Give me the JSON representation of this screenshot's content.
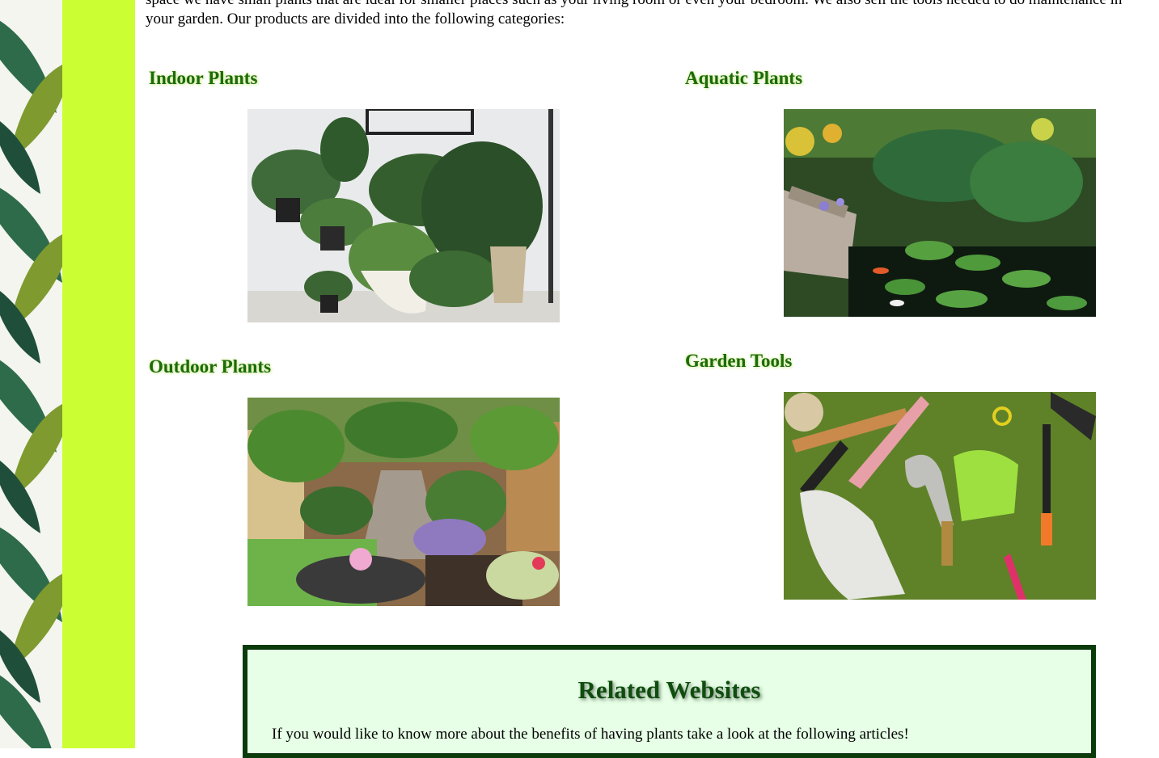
{
  "intro": {
    "line1": "space we have small plants that are ideal for smaller places such as your living room or even your bedroom. We also sell the tools needed to do maintenance in",
    "line2": "your garden. Our products are divided into the following categories:"
  },
  "categories": [
    {
      "title": "Indoor Plants",
      "image": "indoor-plants-photo"
    },
    {
      "title": "Aquatic Plants",
      "image": "aquatic-plants-photo"
    },
    {
      "title": "Outdoor Plants",
      "image": "outdoor-plants-photo"
    },
    {
      "title": "Garden Tools",
      "image": "garden-tools-photo"
    }
  ],
  "related": {
    "heading": "Related Websites",
    "text": "If you would like to know more about the benefits of having plants take a look at the following articles!"
  },
  "colors": {
    "lime_sidebar": "#ccff33",
    "heading_green": "#1d6b0a",
    "related_border": "#0b3a0b",
    "related_bg": "#e6ffe6"
  }
}
